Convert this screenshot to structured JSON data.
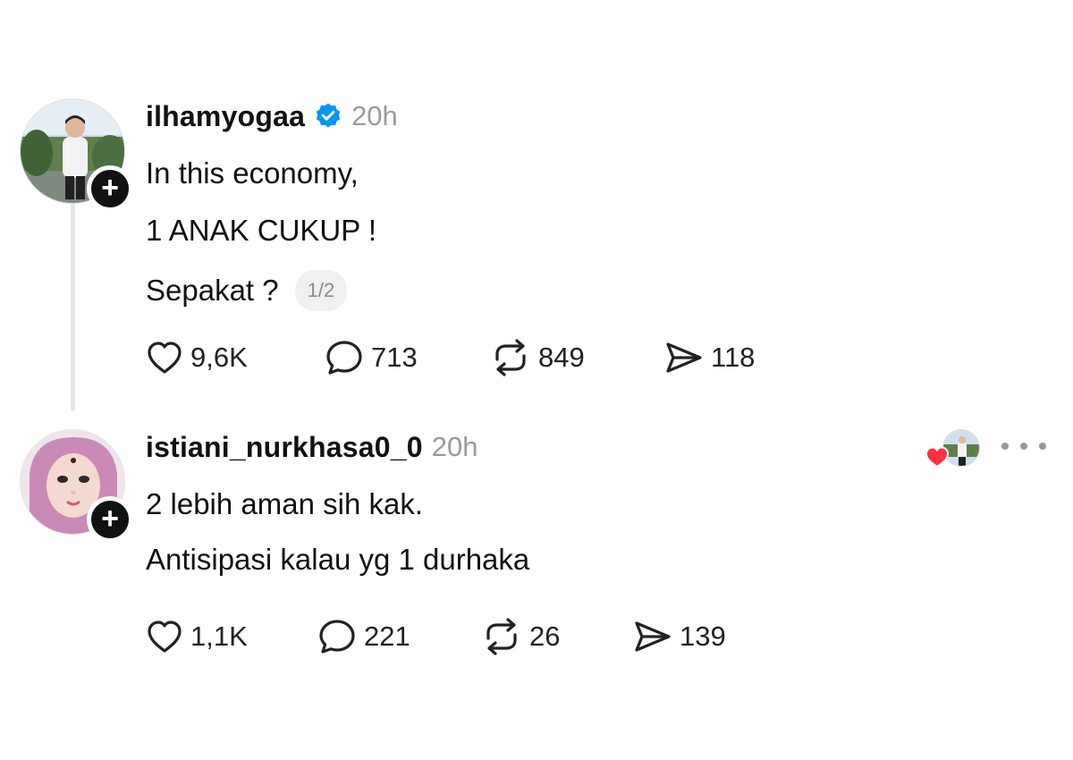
{
  "posts": [
    {
      "username": "ilhamyogaa",
      "verified": true,
      "time": "20h",
      "lines": [
        "In this economy,",
        "1 ANAK CUKUP !",
        "Sepakat ?"
      ],
      "pager": "1/2",
      "likes": "9,6K",
      "replies": "713",
      "reposts": "849",
      "shares": "118",
      "follow_icon": "plus-icon",
      "follow_label": "+"
    },
    {
      "username": "istiani_nurkhasa0_0",
      "verified": false,
      "time": "20h",
      "lines": [
        "2 lebih aman sih kak.",
        "Antisipasi kalau yg 1 durhaka"
      ],
      "likes": "1,1K",
      "replies": "221",
      "reposts": "26",
      "shares": "139",
      "follow_icon": "plus-icon",
      "follow_label": "+",
      "liked_by_creator": true
    }
  ],
  "colors": {
    "heart_red": "#ff3040",
    "verified_blue": "#0095f6",
    "muted_gray": "#9a9a9a",
    "thread_line": "#e6e6e6"
  },
  "icons": [
    "heart-icon",
    "comment-icon",
    "repost-icon",
    "share-icon",
    "verified-badge-icon",
    "more-icon"
  ]
}
